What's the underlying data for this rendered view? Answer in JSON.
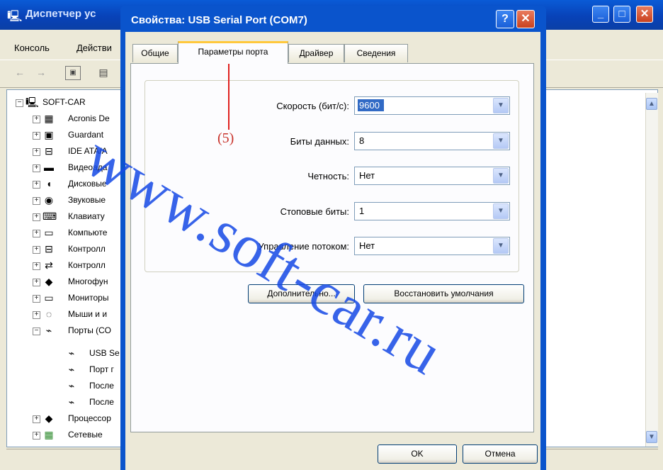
{
  "background_window": {
    "title": "Диспетчер ус",
    "menu": [
      "Консоль",
      "Действи"
    ],
    "tree": {
      "root": "SOFT-CAR",
      "items": [
        "Acronis De",
        "Guardant",
        "IDE ATA/A",
        "Видеоада",
        "Дисковые",
        "Звуковые",
        "Клавиату",
        "Компьюте",
        "Контролл",
        "Контролл",
        "Многофун",
        "Мониторы",
        "Мыши и и",
        "Порты (СО"
      ],
      "ports_children": [
        "USB Se",
        "Порт г",
        "После",
        "После"
      ],
      "items_after": [
        "Процессор",
        "Сетевые"
      ]
    }
  },
  "dialog": {
    "title": "Свойства: USB Serial Port (COM7)",
    "help_label": "?",
    "close_label": "✕",
    "tabs": [
      "Общие",
      "Параметры порта",
      "Драйвер",
      "Сведения"
    ],
    "fields": [
      {
        "label": "Скорость (бит/с):",
        "value": "9600"
      },
      {
        "label": "Биты данных:",
        "value": "8"
      },
      {
        "label": "Четность:",
        "value": "Нет"
      },
      {
        "label": "Стоповые биты:",
        "value": "1"
      },
      {
        "label": "Управление потоком:",
        "value": "Нет"
      }
    ],
    "advanced_button": "Дополнительно...",
    "restore_button": "Восстановить умолчания",
    "ok_button": "OK",
    "cancel_button": "Отмена"
  },
  "annotation": "(5)",
  "watermark": "www.soft-car.ru",
  "colors": {
    "title_bar": "#0a54cc",
    "window_face": "#ece9d8",
    "selection": "#316ac5",
    "annotation": "#e0211f",
    "watermark": "#1549e6"
  }
}
